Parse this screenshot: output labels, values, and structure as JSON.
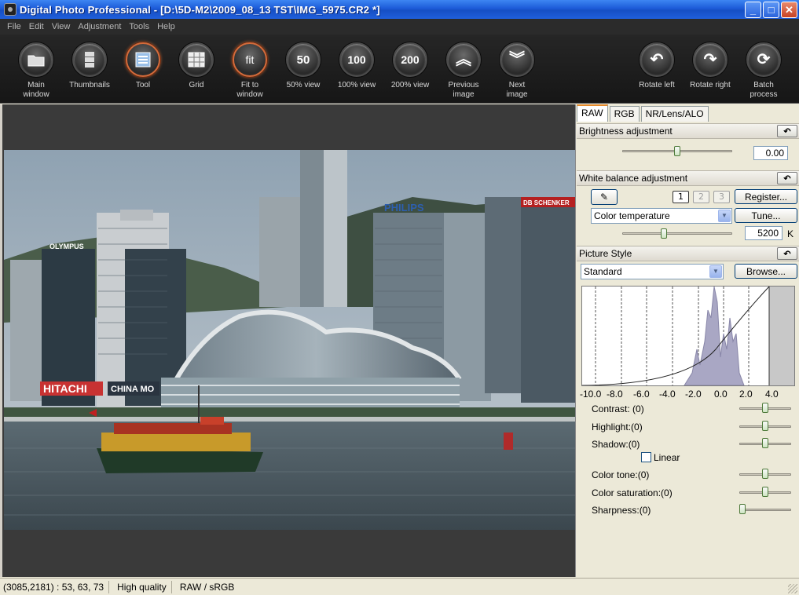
{
  "window": {
    "title": "Digital Photo Professional - [D:\\5D-M2\\2009_08_13 TST\\IMG_5975.CR2 *]"
  },
  "menu": [
    "File",
    "Edit",
    "View",
    "Adjustment",
    "Tools",
    "Help"
  ],
  "toolbar": {
    "main_window": "Main\nwindow",
    "thumbnails": "Thumbnails",
    "tool": "Tool",
    "grid": "Grid",
    "fit": "Fit to\nwindow",
    "fit_glyph": "fit",
    "view50": "50% view",
    "view50_glyph": "50",
    "view100": "100% view",
    "view100_glyph": "100",
    "view200": "200% view",
    "view200_glyph": "200",
    "prev": "Previous\nimage",
    "next": "Next\nimage",
    "rotate_left": "Rotate left",
    "rotate_right": "Rotate right",
    "batch": "Batch\nprocess"
  },
  "photo": {
    "signs": {
      "olympus": "OLYMPUS",
      "hitachi": "HITACHI",
      "china": "CHINA MO",
      "philips": "PHILIPS",
      "schenker": "DB SCHENKER"
    }
  },
  "panel": {
    "tabs": [
      "RAW",
      "RGB",
      "NR/Lens/ALO"
    ],
    "brightness": {
      "header": "Brightness adjustment",
      "value": "0.00",
      "slider_pos": 0.5
    },
    "white_balance": {
      "header": "White balance adjustment",
      "presets": [
        "1",
        "2",
        "3"
      ],
      "register": "Register...",
      "mode": "Color temperature",
      "tune": "Tune...",
      "temperature": "5200",
      "unit": "K",
      "slider_pos": 0.37
    },
    "picture_style": {
      "header": "Picture Style",
      "style": "Standard",
      "browse": "Browse...",
      "hist_axis": [
        "-10.0",
        "-8.0",
        "-6.0",
        "-4.0",
        "-2.0",
        "0.0",
        "2.0",
        "4.0"
      ],
      "adjustments": [
        {
          "label": "Contrast: (0)",
          "pos": 0.5
        },
        {
          "label": "Highlight:(0)",
          "pos": 0.5
        },
        {
          "label": "Shadow:(0)",
          "pos": 0.5
        },
        {
          "label": "Color tone:(0)",
          "pos": 0.5
        },
        {
          "label": "Color saturation:(0)",
          "pos": 0.5
        },
        {
          "label": "Sharpness:(0)",
          "pos": 0.0
        }
      ],
      "linear_label": "Linear"
    }
  },
  "status": {
    "coords": "(3085,2181) :  53, 63, 73",
    "quality": "High quality",
    "mode": "RAW / sRGB"
  },
  "colors": {
    "accent": "#e68b2c",
    "titlebar": "#1c5ad8"
  }
}
